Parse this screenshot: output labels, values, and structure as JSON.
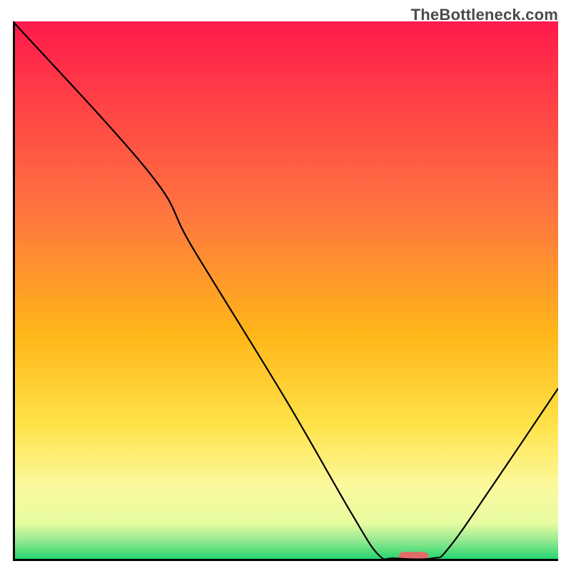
{
  "watermark": "TheBottleneck.com",
  "chart_data": {
    "type": "line",
    "title": "",
    "xlabel": "",
    "ylabel": "",
    "xlim": [
      0,
      100
    ],
    "ylim": [
      0,
      100
    ],
    "gradient_stops": [
      {
        "offset": 0.0,
        "color": "#ff1a4b"
      },
      {
        "offset": 0.35,
        "color": "#ff7440"
      },
      {
        "offset": 0.58,
        "color": "#ffb618"
      },
      {
        "offset": 0.75,
        "color": "#ffe34a"
      },
      {
        "offset": 0.86,
        "color": "#fbf99e"
      },
      {
        "offset": 0.93,
        "color": "#e7fca0"
      },
      {
        "offset": 0.965,
        "color": "#8de88f"
      },
      {
        "offset": 1.0,
        "color": "#17d36a"
      }
    ],
    "series": [
      {
        "name": "curve",
        "points": [
          {
            "x": 0.0,
            "y": 100.0
          },
          {
            "x": 25.0,
            "y": 72.0
          },
          {
            "x": 33.0,
            "y": 58.0
          },
          {
            "x": 50.0,
            "y": 30.0
          },
          {
            "x": 62.0,
            "y": 9.0
          },
          {
            "x": 67.0,
            "y": 1.2
          },
          {
            "x": 70.0,
            "y": 0.5
          },
          {
            "x": 77.0,
            "y": 0.5
          },
          {
            "x": 80.0,
            "y": 2.5
          },
          {
            "x": 88.0,
            "y": 14.0
          },
          {
            "x": 100.0,
            "y": 32.0
          }
        ]
      }
    ],
    "marker": {
      "x": 73.5,
      "y": 0.5,
      "width": 5.5,
      "color": "#e46a6a"
    },
    "axis_color": "#000000"
  }
}
